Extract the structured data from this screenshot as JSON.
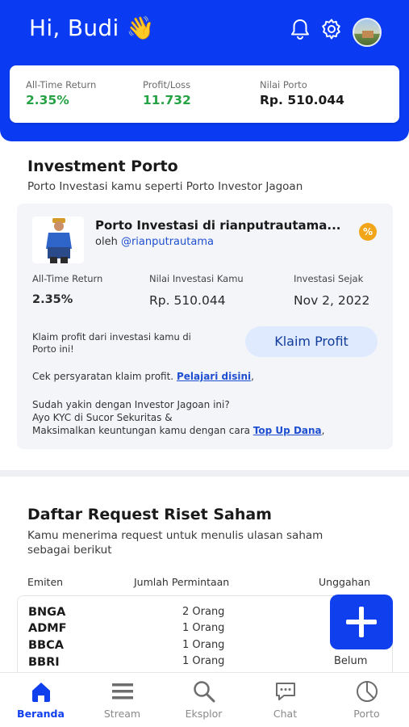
{
  "header": {
    "greeting": "Hi, Budi",
    "wave_emoji": "👋",
    "icons": [
      "bell-icon",
      "gear-icon",
      "avatar"
    ]
  },
  "summary": {
    "return_label": "All-Time Return",
    "return_value": "2.35%",
    "profit_label": "Profit/Loss",
    "profit_value": "11.732",
    "porto_label": "Nilai Porto",
    "porto_value": "Rp. 510.044"
  },
  "investment": {
    "title": "Investment Porto",
    "subtitle": "Porto Investasi kamu seperti Porto Investor Jagoan",
    "card": {
      "name": "Porto Investasi di rianputrautama...",
      "by_prefix": "oleh",
      "handle": "@rianputrautama",
      "badge": "%",
      "return_label": "All-Time Return",
      "return_value": "2.35%",
      "nilai_label": "Nilai Investasi Kamu",
      "nilai_value": "Rp. 510.044",
      "sejak_label": "Investasi Sejak",
      "sejak_value": "Nov 2, 2022",
      "klaim_text": "Klaim profit dari investasi kamu di Porto ini!",
      "klaim_button": "Klaim Profit",
      "cek_text": "Cek persyaratan klaim profit.",
      "cek_link": "Pelajari disini",
      "sudah_line1": "Sudah yakin dengan Investor Jagoan ini?",
      "sudah_line2": "Ayo KYC di Sucor Sekuritas &",
      "sudah_line3": "Maksimalkan keuntungan kamu dengan cara",
      "topup_link": "Top Up Dana"
    }
  },
  "riset": {
    "title": "Daftar Request Riset Saham",
    "subtitle_line1": "Kamu menerima request untuk menulis ulasan saham",
    "subtitle_line2": "sebagai berikut",
    "col_emiten": "Emiten",
    "col_jumlah": "Jumlah Permintaan",
    "col_unggahan": "Unggahan",
    "rows": [
      {
        "code": "BNGA",
        "count": "2 Orang",
        "status": ""
      },
      {
        "code": "ADMF",
        "count": "1 Orang",
        "status": ""
      },
      {
        "code": "BBCA",
        "count": "1 Orang",
        "status": ""
      },
      {
        "code": "BBRI",
        "count": "1 Orang",
        "status": "Belum"
      }
    ]
  },
  "nav": [
    {
      "label": "Beranda",
      "icon": "home-icon",
      "active": true
    },
    {
      "label": "Stream",
      "icon": "stream-icon",
      "active": false
    },
    {
      "label": "Eksplor",
      "icon": "search-icon",
      "active": false
    },
    {
      "label": "Chat",
      "icon": "chat-icon",
      "active": false
    },
    {
      "label": "Porto",
      "icon": "pie-chart-icon",
      "active": false
    }
  ],
  "colors": {
    "brand": "#0a3bf2",
    "positive": "#25a244",
    "link": "#1f4fd1"
  }
}
